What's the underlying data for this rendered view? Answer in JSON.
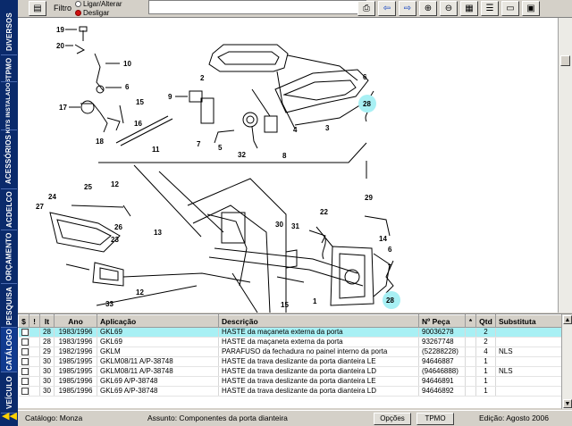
{
  "sidetabs": [
    "VEÍCULO",
    "CATÁLOGO",
    "PESQUISA",
    "ORÇAMENTO",
    "ACDELCO",
    "ACESSÓRIOS",
    "KITS INSTALADOS",
    "TPMO",
    "DIVERSOS"
  ],
  "toolbar": {
    "filter_label": "Filtro",
    "filter_on": "Ligar/Alterar",
    "filter_off": "Desligar",
    "filter_value": "",
    "icons": [
      "print-icon",
      "arrow-left-icon",
      "arrow-right-icon",
      "zoom-in-icon",
      "zoom-out-icon",
      "grid-icon",
      "list-icon",
      "disk-icon",
      "collapse-icon"
    ]
  },
  "drawing": {
    "callouts": [
      "19",
      "20",
      "10",
      "6",
      "2",
      "7",
      "9",
      "17",
      "15",
      "16",
      "18",
      "11",
      "8",
      "4",
      "3",
      "28",
      "32",
      "5",
      "8",
      "25",
      "12",
      "24",
      "27",
      "26",
      "23",
      "13",
      "12",
      "33",
      "30",
      "31",
      "22",
      "29",
      "14",
      "6",
      "7",
      "15",
      "1",
      "28"
    ],
    "highlighted": [
      "28"
    ]
  },
  "table": {
    "headers": [
      "$",
      "!",
      "It",
      "Ano",
      "Aplicação",
      "Descrição",
      "Nº Peça",
      "*",
      "Qtd",
      "Substitutа"
    ],
    "rows": [
      {
        "it": "28",
        "ano": "1983/1996",
        "aplicacao": "GKL69",
        "descricao": "HASTE da maçaneta externa da porta",
        "peca": "90036278",
        "star": "",
        "qtd": "2",
        "subst": "",
        "selected": true
      },
      {
        "it": "28",
        "ano": "1983/1996",
        "aplicacao": "GKL69",
        "descricao": "HASTE da maçaneta externa da porta",
        "peca": "93267748",
        "star": "",
        "qtd": "2",
        "subst": "",
        "selected": false
      },
      {
        "it": "29",
        "ano": "1982/1996",
        "aplicacao": "GKLM",
        "descricao": "PARAFUSO da fechadura no painel interno da porta",
        "peca": "(52288228)",
        "star": "",
        "qtd": "4",
        "subst": "NLS",
        "selected": false
      },
      {
        "it": "30",
        "ano": "1985/1995",
        "aplicacao": "GKLM08/11 A/P-38748",
        "descricao": "HASTE da trava deslizante da porta dianteira LE",
        "peca": "94646887",
        "star": "",
        "qtd": "1",
        "subst": "",
        "selected": false
      },
      {
        "it": "30",
        "ano": "1985/1995",
        "aplicacao": "GKLM08/11 A/P-38748",
        "descricao": "HASTE da trava deslizante da porta dianteira LD",
        "peca": "(94646888)",
        "star": "",
        "qtd": "1",
        "subst": "NLS",
        "selected": false
      },
      {
        "it": "30",
        "ano": "1985/1996",
        "aplicacao": "GKL69 A/P-38748",
        "descricao": "HASTE da trava deslizante da porta dianteira LE",
        "peca": "94646891",
        "star": "",
        "qtd": "1",
        "subst": "",
        "selected": false
      },
      {
        "it": "30",
        "ano": "1985/1996",
        "aplicacao": "GKL69 A/P-38748",
        "descricao": "HASTE da trava deslizante da porta dianteira LD",
        "peca": "94646892",
        "star": "",
        "qtd": "1",
        "subst": "",
        "selected": false
      }
    ]
  },
  "status": {
    "catalog": "Catálogo: Monza",
    "subject": "Assunto: Componentes da porta dianteira",
    "opcoes": "Opções",
    "tpmo": "TPMO",
    "edition": "Edição: Agosto 2006"
  }
}
